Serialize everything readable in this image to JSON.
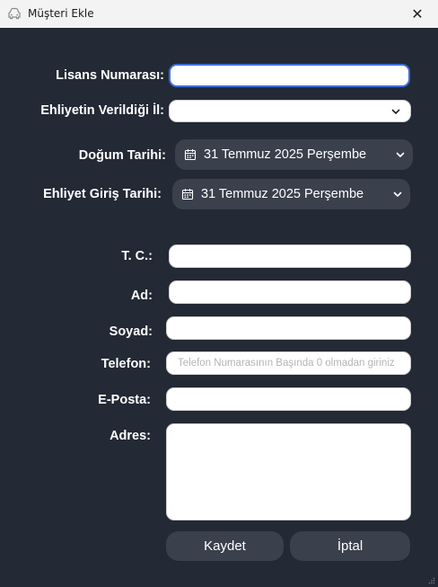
{
  "window": {
    "title": "Müşteri Ekle",
    "close_glyph": "✕",
    "icon": "car-icon"
  },
  "form": {
    "license_label": "Lisans Numarası:",
    "license_value": "",
    "province_label": "Ehliyetin Verildiği İl:",
    "province_value": "",
    "birth_label": "Doğum Tarihi:",
    "birth_value": "31 Temmuz 2025 Perşembe",
    "license_date_label": "Ehliyet Giriş Tarihi:",
    "license_date_value": "31 Temmuz 2025 Perşembe",
    "tc_label": "T. C.:",
    "tc_value": "",
    "name_label": "Ad:",
    "name_value": "",
    "surname_label": "Soyad:",
    "surname_value": "",
    "phone_label": "Telefon:",
    "phone_placeholder": "Telefon Numarasının Başında 0 olmadan giriniz",
    "email_label": "E-Posta:",
    "email_value": "",
    "address_label": "Adres:",
    "address_value": ""
  },
  "buttons": {
    "save": "Kaydet",
    "cancel": "İptal"
  },
  "colors": {
    "background": "#232935",
    "control": "#3a404c",
    "focus": "#3b6fd8"
  }
}
